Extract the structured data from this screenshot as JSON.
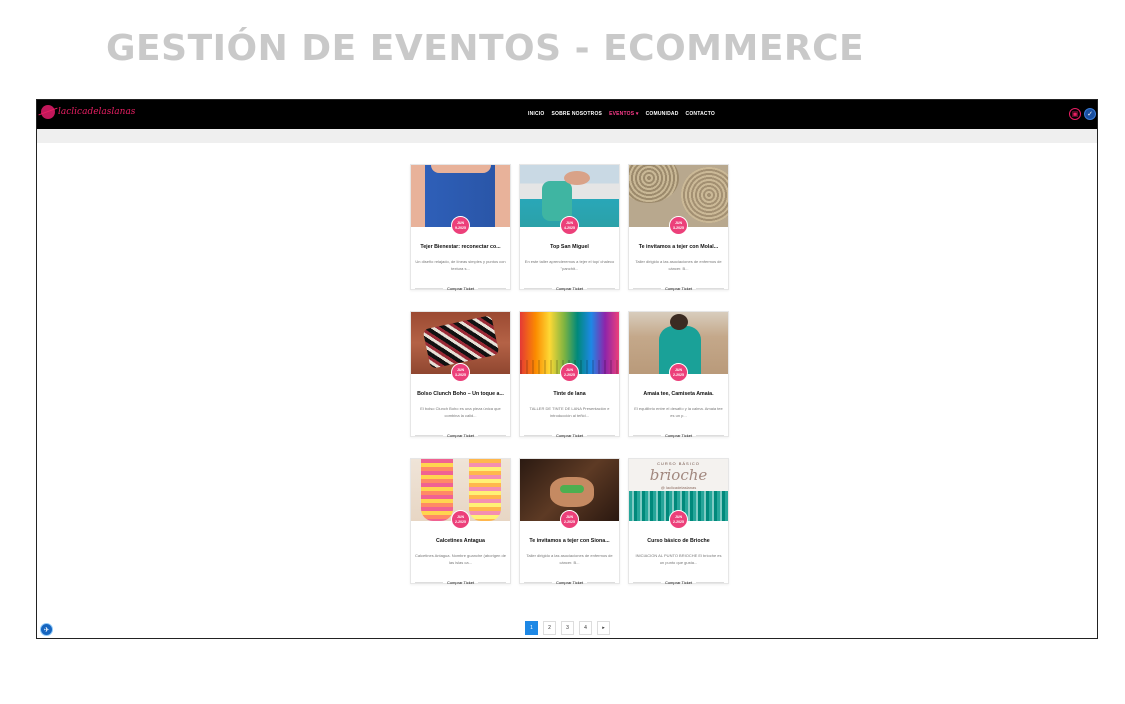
{
  "page_heading": "GESTIÓN DE EVENTOS - ECOMMERCE",
  "brand": {
    "logo_text": "laclicadelaslanas"
  },
  "nav": {
    "items": [
      {
        "label": "INICIO"
      },
      {
        "label": "SOBRE NOSOTROS"
      },
      {
        "label": "EVENTOS ▾"
      },
      {
        "label": "COMUNIDAD"
      },
      {
        "label": "CONTACTO"
      }
    ],
    "active_index": 2
  },
  "colors": {
    "accent": "#ec407a",
    "nav_bg": "#000000",
    "pagination_active": "#1e88e5"
  },
  "events": [
    {
      "month": "JUN",
      "date": "9-2025",
      "title": "Tejer Bienestar: reconectar co...",
      "desc": "Un diseño relajado, de líneas simples y puntos con textura s...",
      "button": "Comprar Ticket"
    },
    {
      "month": "JUN",
      "date": "4-2025",
      "title": "Top San Miguel",
      "desc": "En este taller aprenderemos a tejer el top/ chaleco \"panchit...",
      "button": "Comprar Ticket"
    },
    {
      "month": "JUN",
      "date": "3-2025",
      "title": "Te invitamos a tejer con Molal...",
      "desc": "Taller dirigido a las asociaciones de enfermos de cáncer. B...",
      "button": "Comprar Ticket"
    },
    {
      "month": "JUN",
      "date": "3-2025",
      "title": "Bolso Clunch Boho – Un toque a...",
      "desc": "El bolso Clunch Boho es una pieza única que combina la calid...",
      "button": "Comprar Ticket"
    },
    {
      "month": "JUN",
      "date": "2-2025",
      "title": "Tinte de lana",
      "desc": "TALLER DE TINTE DE LANA Presentación e introducción al teñid...",
      "button": "Comprar Ticket"
    },
    {
      "month": "JUN",
      "date": "2-2025",
      "title": "Amaia tee, Camiseta Amaia.",
      "desc": "El equilibrio entre el desafío y la calma. Amaia tee es un p...",
      "button": "Comprar Ticket"
    },
    {
      "month": "JUN",
      "date": "2-2025",
      "title": "Calcetines Antagua",
      "desc": "Calcetines Antagua. Nombre guanche (aborigen de las islas ca...",
      "button": "Comprar Ticket"
    },
    {
      "month": "JUN",
      "date": "2-2025",
      "title": "Te invitamos a tejer con Siona...",
      "desc": "Taller dirigido a las asociaciones de enfermos de cáncer. B...",
      "button": "Comprar Ticket"
    },
    {
      "month": "JUN",
      "date": "2-2025",
      "title": "Curso básico de Brioche",
      "desc": "INICIACION AL PUNTO BRIOCHE El brioche es un punto que gusta...",
      "button": "Comprar Ticket"
    }
  ],
  "brioche_image": {
    "top": "CURSO BÁSICO",
    "word": "brioche",
    "sub": "@ laclicadelaslanas"
  },
  "pagination": {
    "pages": [
      "1",
      "2",
      "3",
      "4"
    ],
    "next": "▸",
    "current": "1"
  },
  "icons": {
    "cart": "bag-icon",
    "user": "edit-icon",
    "accessibility": "accessibility-icon"
  }
}
